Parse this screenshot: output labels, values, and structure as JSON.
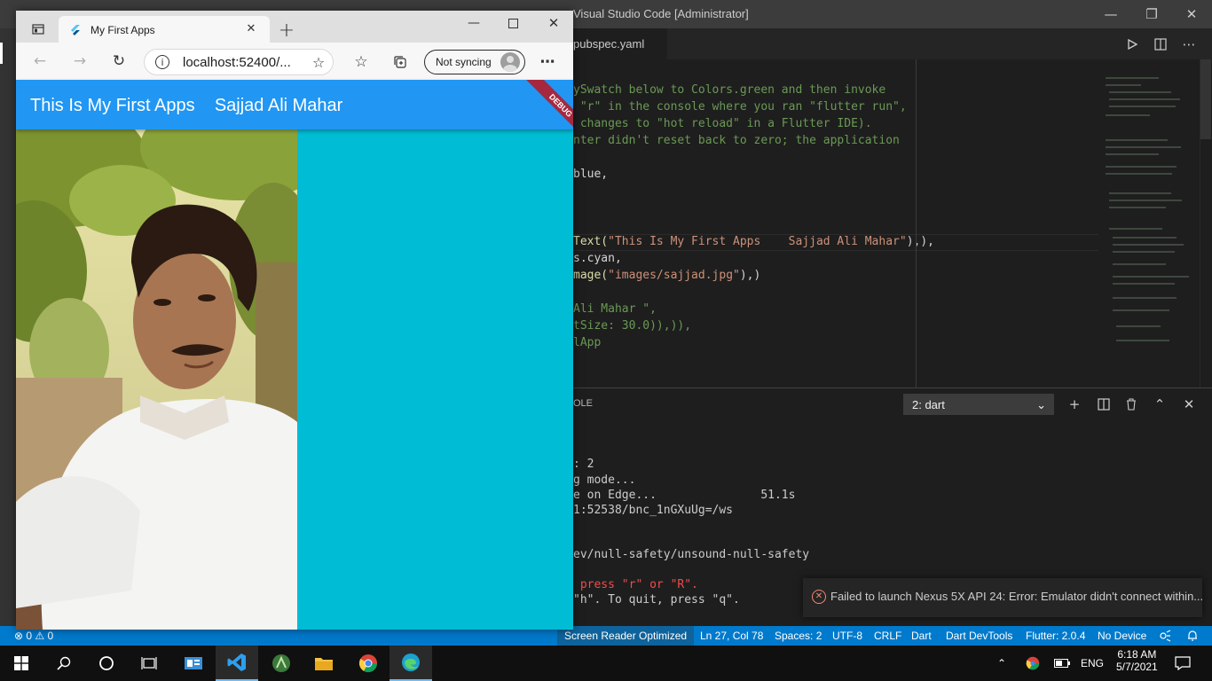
{
  "vscode": {
    "title": "Visual Studio Code [Administrator]",
    "tab_label": "pubspec.yaml",
    "code_lines": [
      {
        "cls": "cmt",
        "text": "    "
      },
      {
        "cls": "cmt",
        "text": "ySwatch below to Colors.green and then invoke"
      },
      {
        "cls": "cmt",
        "text": " \"r\" in the console where you ran \"flutter run\","
      },
      {
        "cls": "cmt",
        "text": " changes to \"hot reload\" in a Flutter IDE)."
      },
      {
        "cls": "cmt",
        "text": "nter didn't reset back to zero; the application"
      },
      {
        "cls": "",
        "text": ""
      },
      {
        "cls": "",
        "text": "blue,"
      },
      {
        "cls": "",
        "text": ""
      },
      {
        "cls": "",
        "text": ""
      },
      {
        "cls": "",
        "text": ""
      },
      {
        "cls": "",
        "text": "s.cyan,"
      },
      {
        "cls": "",
        "text": ""
      },
      {
        "cls": "",
        "text": ""
      },
      {
        "cls": "",
        "text": ""
      },
      {
        "cls": "",
        "text": "tSize: 30.0)),)),"
      },
      {
        "cls": "",
        "text": "lApp"
      }
    ],
    "code_text_call": "Text(",
    "code_text_string": "\"This Is My First Apps    Sajjad Ali Mahar\"",
    "code_text_end": "),),",
    "code_image_call": "mage(",
    "code_image_string": "\"images/sajjad.jpg\"",
    "code_image_end": "),)",
    "code_string_line": "Ali Mahar \",",
    "panel_tab": "OLE",
    "terminal_select": "2: dart",
    "terminal_lines": [
      {
        "cls": "",
        "text": ": 2"
      },
      {
        "cls": "",
        "text": "g mode..."
      },
      {
        "cls": "",
        "text": "e on Edge...               51.1s"
      },
      {
        "cls": "",
        "text": "1:52538/bnc_1nGXuUg=/ws"
      },
      {
        "cls": "",
        "text": ""
      },
      {
        "cls": "",
        "text": ""
      },
      {
        "cls": "",
        "text": "ev/null-safety/unsound-null-safety"
      },
      {
        "cls": "",
        "text": ""
      },
      {
        "cls": "term-red",
        "text": " press \"r\" or \"R\"."
      },
      {
        "cls": "",
        "text": "\"h\". To quit, press \"q\"."
      }
    ],
    "notification": "Failed to launch Nexus 5X API 24: Error: Emulator didn't connect within...",
    "status": {
      "errors": "⊗ 0 ⚠ 0",
      "reader": "Screen Reader Optimized",
      "position": "Ln 27, Col 78",
      "spaces": "Spaces: 2",
      "encoding": "UTF-8",
      "eol": "CRLF",
      "language": "Dart",
      "devtools": "Dart DevTools",
      "flutter": "Flutter: 2.0.4",
      "device": "No Device"
    }
  },
  "browser": {
    "tab_title": "My First Apps",
    "url": "localhost:52400/...",
    "sync_label": "Not syncing",
    "app_bar_title": "This Is My First Apps    Sajjad Ali Mahar",
    "debug_label": "DEBUG"
  },
  "taskbar": {
    "language": "ENG",
    "time": "6:18 AM",
    "date": "5/7/2021"
  },
  "colors": {
    "app_bar": "#2196f3",
    "app_body": "#00bcd4",
    "status_bar": "#007acc"
  }
}
